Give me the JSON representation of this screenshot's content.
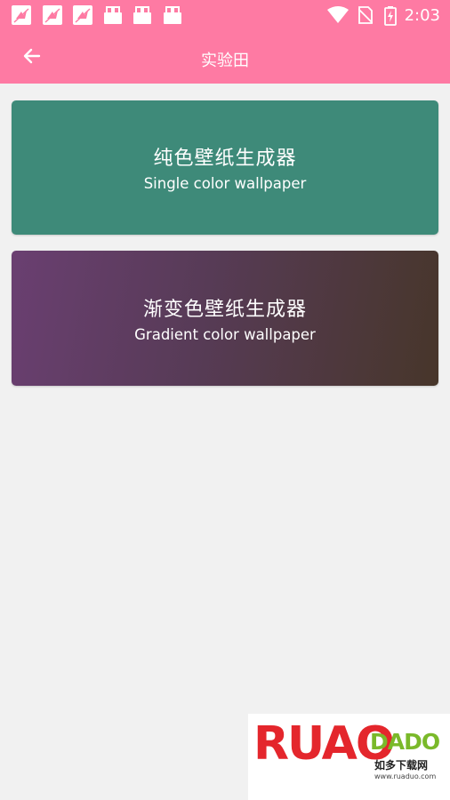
{
  "status_bar": {
    "time": "2:03",
    "left_icons": [
      "butterfly-notification-icon",
      "butterfly-notification-icon",
      "butterfly-notification-icon",
      "shopping-bag-icon",
      "shopping-bag-icon",
      "shopping-bag-icon"
    ],
    "right_icons": [
      "wifi-icon",
      "no-sim-icon",
      "battery-charging-icon"
    ]
  },
  "app_bar": {
    "title": "实验田",
    "back_icon": "arrow-left-icon"
  },
  "cards": [
    {
      "title": "纯色壁纸生成器",
      "subtitle": "Single color wallpaper",
      "background": "#3e8a79"
    },
    {
      "title": "渐变色壁纸生成器",
      "subtitle": "Gradient color wallpaper",
      "gradient_from": "#6a3f71",
      "gradient_to": "#47362a"
    }
  ],
  "watermark": {
    "logo_text": "RUAO",
    "logo_small": "DADO",
    "cn_text": "如多下载网",
    "url": "www.ruaduo.com"
  },
  "colors": {
    "accent": "#fe7aa3",
    "background": "#f1f1f1"
  }
}
